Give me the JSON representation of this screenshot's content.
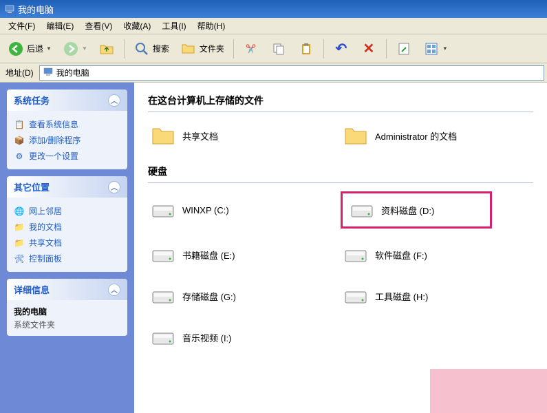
{
  "window": {
    "title": "我的电脑"
  },
  "menubar": {
    "file": "文件(F)",
    "edit": "编辑(E)",
    "view": "查看(V)",
    "favorites": "收藏(A)",
    "tools": "工具(I)",
    "help": "帮助(H)"
  },
  "toolbar": {
    "back": "后退",
    "search": "搜索",
    "folders": "文件夹"
  },
  "addressbar": {
    "label": "地址(D)",
    "value": "我的电脑"
  },
  "sidebar": {
    "system_tasks": {
      "title": "系统任务",
      "links": {
        "view_info": "查看系统信息",
        "add_remove": "添加/删除程序",
        "change_setting": "更改一个设置"
      }
    },
    "other_places": {
      "title": "其它位置",
      "links": {
        "network": "网上邻居",
        "my_docs": "我的文档",
        "shared_docs": "共享文档",
        "control_panel": "控制面板"
      }
    },
    "details": {
      "title": "详细信息",
      "name": "我的电脑",
      "type": "系统文件夹"
    }
  },
  "content": {
    "section_files": "在这台计算机上存储的文件",
    "section_drives": "硬盘",
    "folders": {
      "shared": "共享文档",
      "admin": "Administrator 的文档"
    },
    "drives": {
      "c": "WINXP (C:)",
      "d": "资料磁盘 (D:)",
      "e": "书籍磁盘 (E:)",
      "f": "软件磁盘 (F:)",
      "g": "存储磁盘 (G:)",
      "h": "工具磁盘 (H:)",
      "i": "音乐视频 (I:)"
    }
  }
}
